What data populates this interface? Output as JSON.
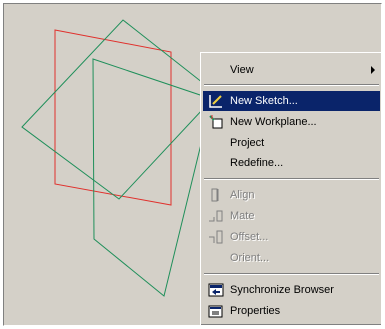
{
  "menu": {
    "view": "View",
    "new_sketch": "New Sketch...",
    "new_workplane": "New Workplane...",
    "project": "Project",
    "redefine": "Redefine...",
    "align": "Align",
    "mate": "Mate",
    "offset": "Offset...",
    "orient": "Orient...",
    "sync_browser": "Synchronize Browser",
    "properties": "Properties"
  },
  "colors": {
    "red_plane": "#e0302c",
    "green_plane": "#1f8f5a",
    "menu_bg": "#d4d0c8",
    "highlight": "#0a246a"
  }
}
